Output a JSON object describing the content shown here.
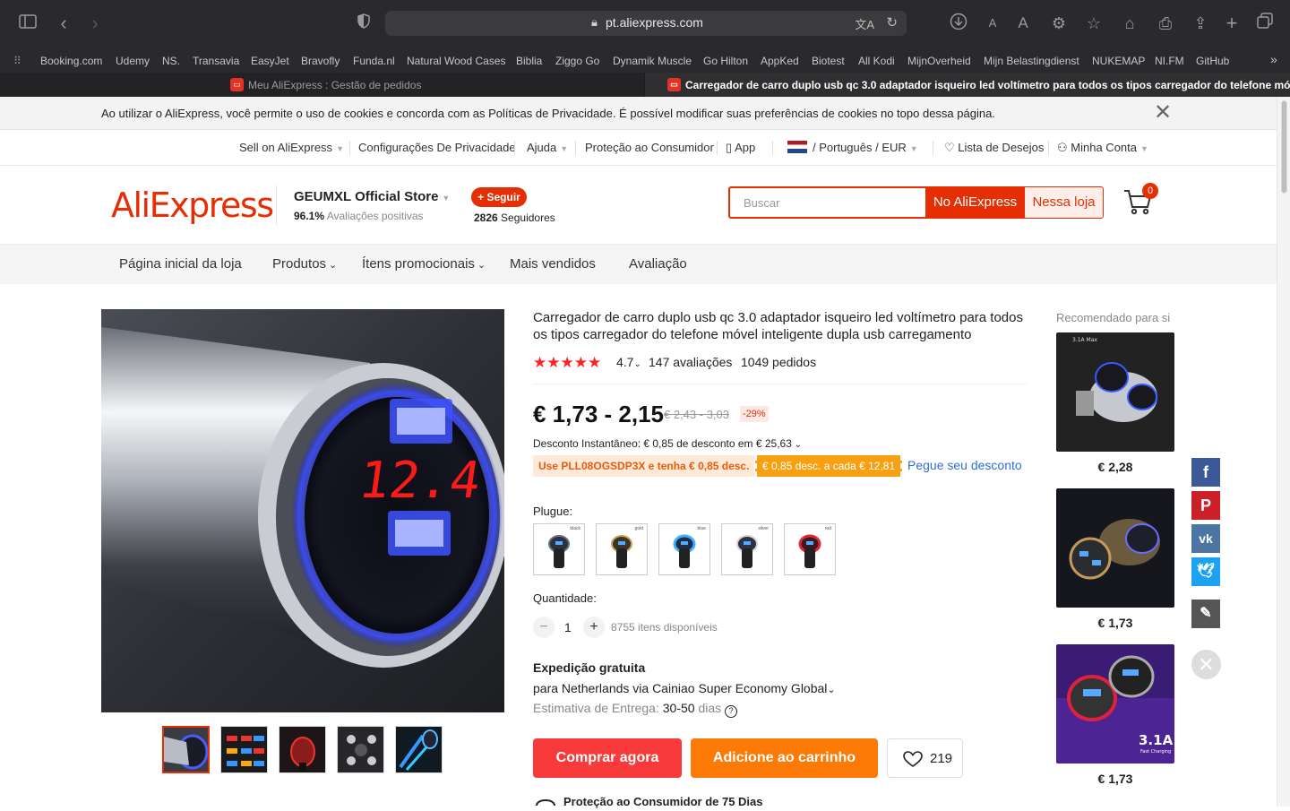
{
  "browser": {
    "url": "pt.aliexpress.com",
    "bookmarks": [
      "Booking.com",
      "Udemy",
      "NS.",
      "Transavia",
      "EasyJet",
      "Bravofly",
      "Funda.nl",
      "Natural Wood Cases",
      "Biblia",
      "Ziggo Go",
      "Dynamik Muscle",
      "Go Hilton",
      "AppKed",
      "Biotest",
      "All Kodi",
      "MijnOverheid",
      "Mijn Belastingdienst",
      "NUKEMAP",
      "NI.FM",
      "GitHub"
    ],
    "tabs": [
      {
        "title": "Meu AliExpress : Gestão de pedidos"
      },
      {
        "title": "Carregador de carro duplo usb qc 3.0 adaptador isqueiro led voltímetro para todos os tipos carregador do telefone móvel intel..."
      }
    ]
  },
  "cookie_banner": {
    "text": "Ao utilizar o AliExpress, você permite o uso de cookies e concorda com as Políticas de Privacidade. É possível modificar suas preferências de cookies no topo dessa página."
  },
  "topnav": {
    "sell": "Sell on AliExpress",
    "privacy": "Configurações De Privacidade",
    "help": "Ajuda",
    "protection": "Proteção ao Consumidor",
    "app": "App",
    "locale": "/ Português /  EUR",
    "wishlist": "Lista de Desejos",
    "account": "Minha Conta"
  },
  "store": {
    "logo": "AliExpress",
    "name": "GEUMXL Official Store",
    "rating_pct": "96.1%",
    "rating_label": "Avaliações positivas",
    "follow": "+ Seguir",
    "followers_count": "2826",
    "followers_label": "Seguidores"
  },
  "search": {
    "placeholder": "Buscar",
    "btn_all": "No AliExpress",
    "btn_store": "Nessa loja",
    "cart_count": "0"
  },
  "store_nav": [
    "Página inicial da loja",
    "Produtos",
    "Ítens promocionais",
    "Mais vendidos",
    "Avaliação"
  ],
  "product": {
    "title": "Carregador de carro duplo usb qc 3.0 adaptador isqueiro led voltímetro para todos os tipos carregador do telefone móvel inteligente dupla usb carregamento",
    "rating": "4.7",
    "reviews": "147 avaliações",
    "orders": "1049 pedidos",
    "price": "€ 1,73 - 2,15",
    "old_price": "€ 2,43 - 3,03",
    "discount": "-29%",
    "instant_discount": "Desconto Instantâneo: € 0,85 de desconto em € 25,63",
    "coupon_code": "Use PLL08OGSDP3X e tenha € 0,85 desc.",
    "coupon_every": "€ 0,85 desc. a cada € 12,81",
    "get_discount": "Pegue seu desconto",
    "plug_label": "Plugue:",
    "variants": [
      "black",
      "gold",
      "blue",
      "silver",
      "red"
    ],
    "qty_label": "Quantidade:",
    "qty": "1",
    "available": "8755 itens disponíveis",
    "shipping_title": "Expedição gratuita",
    "shipping_detail": "para Netherlands via Cainiao Super Economy Global",
    "delivery_label": "Estimativa de Entrega:",
    "delivery_days": "30-50",
    "delivery_unit": "dias",
    "buy_now": "Comprar agora",
    "add_cart": "Adicione ao carrinho",
    "wish_count": "219",
    "protection": "Proteção ao Consumidor de 75 Dias",
    "led_display": "12.4"
  },
  "recommended": {
    "title": "Recomendado para si",
    "items": [
      {
        "price": "€ 2,28",
        "badge": "3.1A Max"
      },
      {
        "price": "€ 1,73"
      },
      {
        "price": "€ 1,73",
        "badge": "3.1A",
        "badge_sub": "Fast Charging"
      }
    ]
  },
  "colors": {
    "brand": "#e62e04",
    "buy": "#f83a3a",
    "cart": "#fd7a06",
    "link": "#2e6fd1"
  }
}
